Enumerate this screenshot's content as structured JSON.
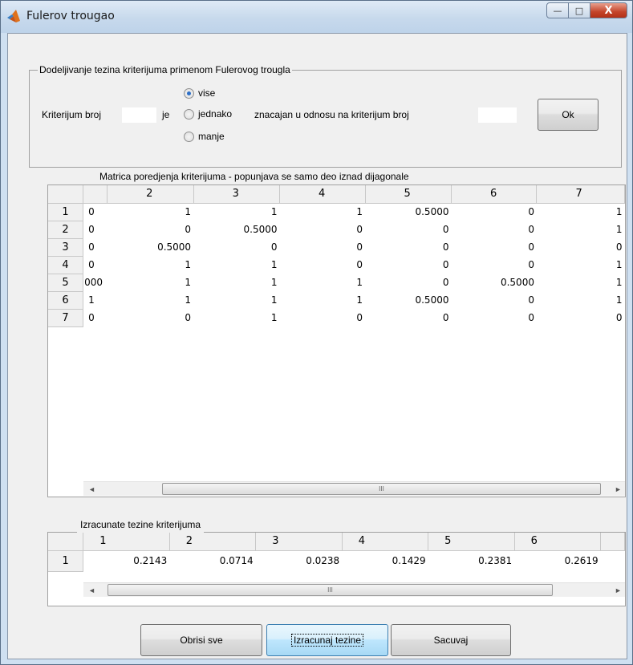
{
  "window": {
    "title": "Fulerov trougao",
    "minimize": "—",
    "maximize": "□",
    "close": "X"
  },
  "group": {
    "title": "Dodeljivanje tezina kriterijuma primenom Fulerovog trougla",
    "label_kriterijum": "Kriterijum broj",
    "label_je": "je",
    "radio_vise": "vise",
    "radio_jednako": "jednako",
    "radio_manje": "manje",
    "selected_radio": "vise",
    "label_znacajan": "znacajan u odnosu na kriterijum broj",
    "input1_value": "",
    "input2_value": "",
    "ok_label": "Ok"
  },
  "matrix": {
    "caption": "Matrica poredjenja kriterijuma - popunjava se samo deo iznad dijagonale",
    "columns": [
      "",
      "2",
      "3",
      "4",
      "5",
      "6",
      "7"
    ],
    "rows": [
      {
        "label": "1",
        "cells": [
          "0",
          "1",
          "1",
          "1",
          "0.5000",
          "0",
          "1"
        ]
      },
      {
        "label": "2",
        "cells": [
          "0",
          "0",
          "0.5000",
          "0",
          "0",
          "0",
          "1"
        ]
      },
      {
        "label": "3",
        "cells": [
          "0",
          "0.5000",
          "0",
          "0",
          "0",
          "0",
          "0"
        ]
      },
      {
        "label": "4",
        "cells": [
          "0",
          "1",
          "1",
          "0",
          "0",
          "0",
          "1"
        ]
      },
      {
        "label": "5",
        "cells": [
          "000",
          "1",
          "1",
          "1",
          "0",
          "0.5000",
          "1"
        ]
      },
      {
        "label": "6",
        "cells": [
          "1",
          "1",
          "1",
          "1",
          "0.5000",
          "0",
          "1"
        ]
      },
      {
        "label": "7",
        "cells": [
          "0",
          "0",
          "1",
          "0",
          "0",
          "0",
          "0"
        ]
      }
    ],
    "scroll_left": "◄",
    "scroll_right": "►",
    "scroll_grip": "III"
  },
  "weights": {
    "caption": "Izracunate tezine kriterijuma",
    "columns": [
      "1",
      "2",
      "3",
      "4",
      "5",
      "6"
    ],
    "rows": [
      {
        "label": "1",
        "cells": [
          "0.2143",
          "0.0714",
          "0.0238",
          "0.1429",
          "0.2381",
          "0.2619"
        ]
      }
    ],
    "scroll_left": "◄",
    "scroll_right": "►",
    "scroll_grip": "III"
  },
  "buttons": {
    "clear": "Obrisi sve",
    "compute": "Izracunaj tezine",
    "save": "Sacuvaj"
  },
  "colors": {
    "title_bar": "#c7d9ec",
    "client_bg": "#f0f0f0",
    "accent": "#2d6fc7"
  }
}
